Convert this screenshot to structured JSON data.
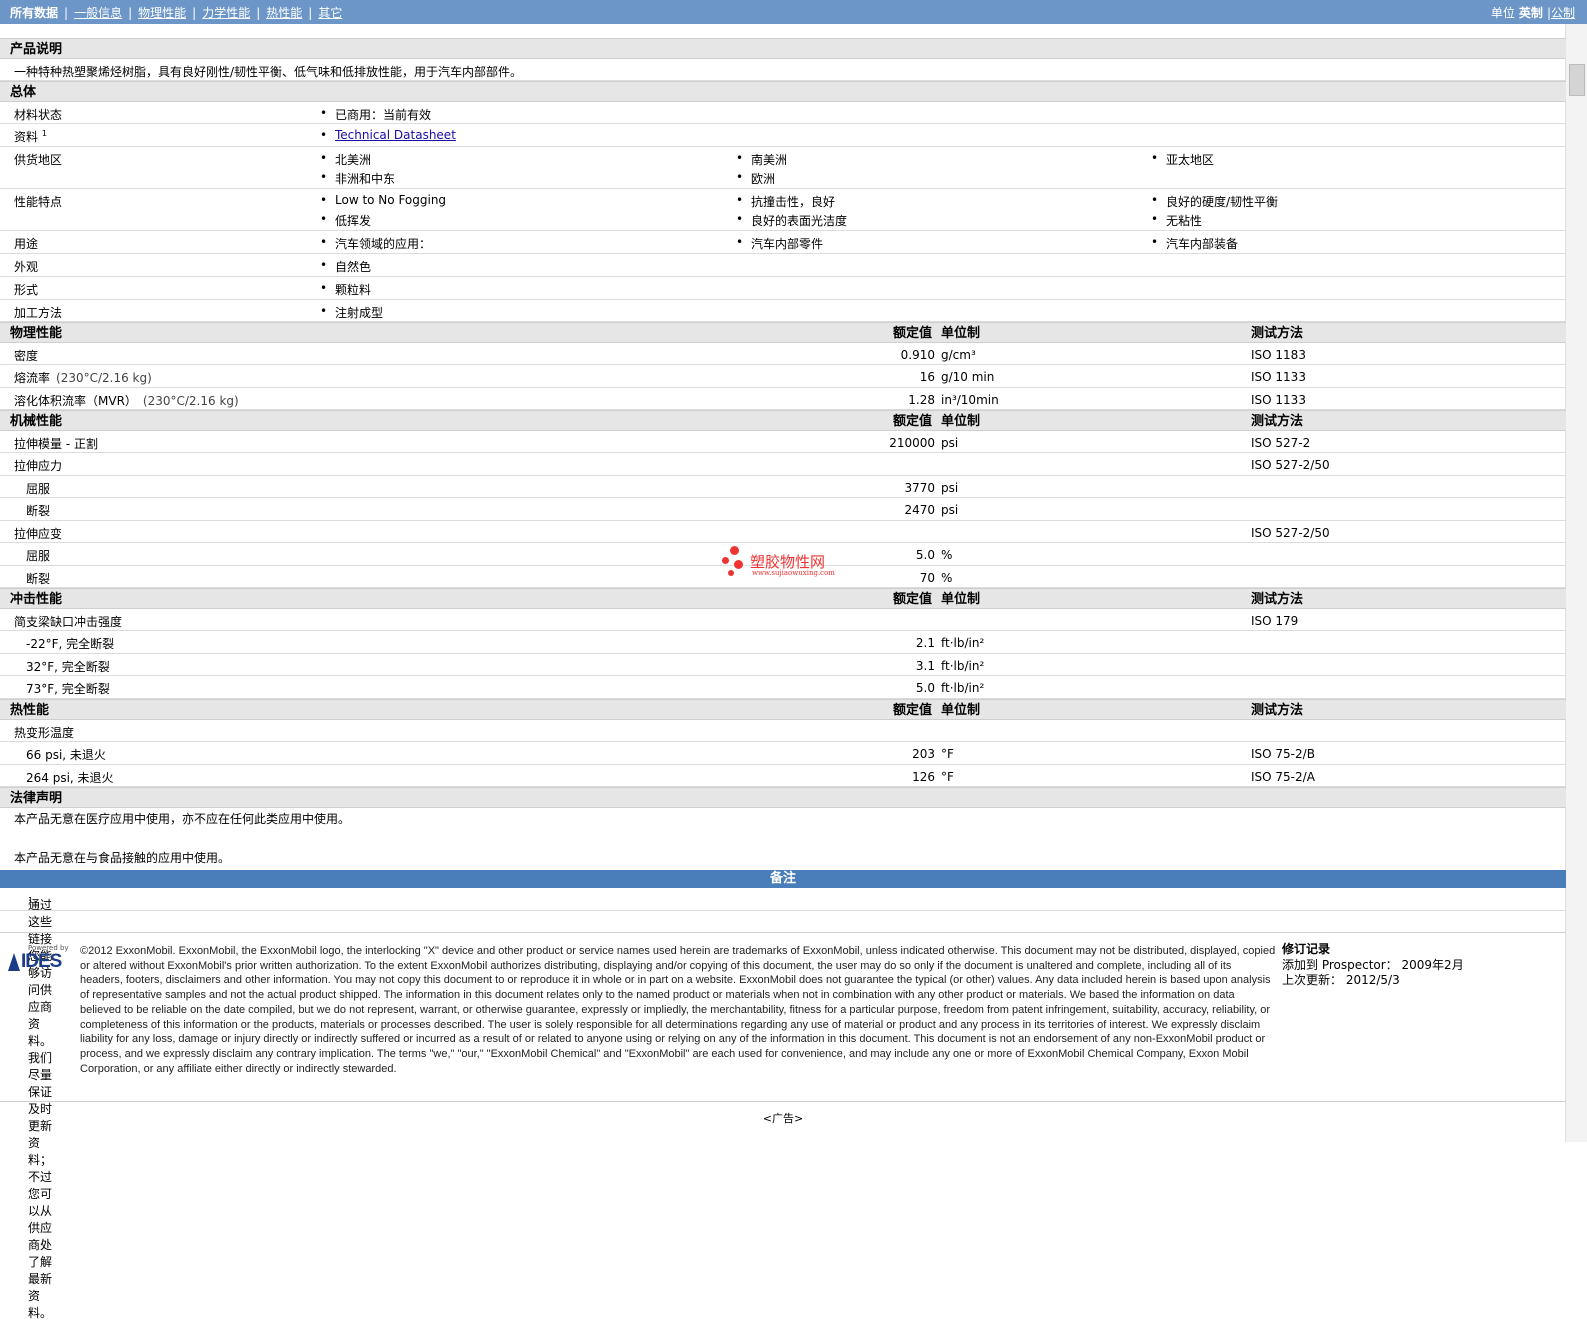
{
  "nav": {
    "items": [
      "所有数据",
      "一般信息",
      "物理性能",
      "力学性能",
      "热性能",
      "其它"
    ],
    "units_label": "单位",
    "unit_active": "英制",
    "unit_other": "公制"
  },
  "product_description": {
    "title": "产品说明",
    "text": "一种特种热塑聚烯烃树脂，具有良好刚性/韧性平衡、低气味和低排放性能，用于汽车内部部件。"
  },
  "general": {
    "title": "总体",
    "material_status": {
      "label": "材料状态",
      "values": [
        "已商用：当前有效"
      ]
    },
    "documents": {
      "label": "资料",
      "sup": "1",
      "values": [
        "Technical Datasheet"
      ]
    },
    "availability": {
      "label": "供货地区",
      "values": [
        "北美洲",
        "南美洲",
        "亚太地区",
        "非洲和中东",
        "欧洲"
      ]
    },
    "features": {
      "label": "性能特点",
      "values": [
        "Low to No Fogging",
        "抗撞击性，良好",
        "良好的硬度/韧性平衡",
        "低挥发",
        "良好的表面光洁度",
        "无粘性"
      ]
    },
    "uses": {
      "label": "用途",
      "values": [
        "汽车领域的应用：",
        "汽车内部零件",
        "汽车内部装备"
      ]
    },
    "appearance": {
      "label": "外观",
      "values": [
        "自然色"
      ]
    },
    "form": {
      "label": "形式",
      "values": [
        "颗粒料"
      ]
    },
    "processing": {
      "label": "加工方法",
      "values": [
        "注射成型"
      ]
    }
  },
  "headers": {
    "value": "额定值",
    "unit": "单位制",
    "test": "测试方法"
  },
  "physical": {
    "title": "物理性能",
    "rows": [
      {
        "label": "密度",
        "cond": "",
        "value": "0.910",
        "unit": "g/cm³",
        "test": "ISO 1183"
      },
      {
        "label": "熔流率",
        "cond": "(230°C/2.16 kg)",
        "value": "16",
        "unit": "g/10 min",
        "test": "ISO 1133"
      },
      {
        "label": "溶化体积流率（MVR）",
        "cond": "(230°C/2.16 kg)",
        "value": "1.28",
        "unit": "in³/10min",
        "test": "ISO 1133"
      }
    ]
  },
  "mechanical": {
    "title": "机械性能",
    "rows": [
      {
        "label": "拉伸模量 - 正割",
        "value": "210000",
        "unit": "psi",
        "test": "ISO 527-2"
      },
      {
        "label": "拉伸应力",
        "value": "",
        "unit": "",
        "test": "ISO 527-2/50"
      },
      {
        "label": "屈服",
        "value": "3770",
        "unit": "psi",
        "test": ""
      },
      {
        "label": "断裂",
        "value": "2470",
        "unit": "psi",
        "test": ""
      },
      {
        "label": "拉伸应变",
        "value": "",
        "unit": "",
        "test": "ISO 527-2/50"
      },
      {
        "label": "屈服",
        "value": "5.0",
        "unit": "%",
        "test": ""
      },
      {
        "label": "断裂",
        "value": "70",
        "unit": "%",
        "test": ""
      }
    ]
  },
  "impact": {
    "title": "冲击性能",
    "rows": [
      {
        "label": "简支梁缺口冲击强度",
        "value": "",
        "unit": "",
        "test": "ISO 179"
      },
      {
        "label": "-22°F, 完全断裂",
        "value": "2.1",
        "unit": "ft·lb/in²",
        "test": ""
      },
      {
        "label": "32°F, 完全断裂",
        "value": "3.1",
        "unit": "ft·lb/in²",
        "test": ""
      },
      {
        "label": "73°F, 完全断裂",
        "value": "5.0",
        "unit": "ft·lb/in²",
        "test": ""
      }
    ]
  },
  "thermal": {
    "title": "热性能",
    "rows": [
      {
        "label": "热变形温度",
        "value": "",
        "unit": "",
        "test": ""
      },
      {
        "label": "66 psi, 未退火",
        "value": "203",
        "unit": "°F",
        "test": "ISO 75-2/B"
      },
      {
        "label": "264 psi, 未退火",
        "value": "126",
        "unit": "°F",
        "test": "ISO 75-2/A"
      }
    ]
  },
  "legal": {
    "title": "法律声明",
    "p1": "本产品无意在医疗应用中使用，亦不应在任何此类应用中使用。",
    "p2": "本产品无意在与食品接触的应用中使用。"
  },
  "notes": {
    "title": "备注",
    "sup": "1",
    "text": "通过这些链接您能够访问供应商资料。我们尽量保证及时更新资料；不过您可以从供应商处了解最新资料。"
  },
  "footer": {
    "logo_small": "Powered by",
    "logo_text": "IDES",
    "legal_text": "©2012 ExxonMobil. ExxonMobil, the ExxonMobil logo, the interlocking \"X\" device and other product or service names used herein are trademarks of ExxonMobil, unless indicated otherwise. This document may not be distributed, displayed, copied or altered without ExxonMobil's prior written authorization. To the extent ExxonMobil authorizes distributing, displaying and/or copying of this document, the user may do so only if the document is unaltered and complete, including all of its headers, footers, disclaimers and other information. You may not copy this document to or reproduce it in whole or in part on a website. ExxonMobil does not guarantee the typical (or other) values. Any data included herein is based upon analysis of representative samples and not the actual product shipped. The information in this document relates only to the named product or materials when not in combination with any other product or materials. We based the information on data believed to be reliable on the date compiled, but we do not represent, warrant, or otherwise guarantee, expressly or impliedly, the merchantability, fitness for a particular purpose, freedom from patent infringement, suitability, accuracy, reliability, or completeness of this information or the products, materials or processes described. The user is solely responsible for all determinations regarding any use of material or product and any process in its territories of interest. We expressly disclaim liability for any loss, damage or injury directly or indirectly suffered or incurred as a result of or related to anyone using or relying on any of the information in this document. This document is not an endorsement of any non-ExxonMobil product or process, and we expressly disclaim any contrary implication. The terms \"we,\" \"our,\" \"ExxonMobil Chemical\" and \"ExxonMobil\" are each used for convenience, and may include any one or more of ExxonMobil Chemical Company, Exxon Mobil Corporation, or any affiliate either directly or indirectly stewarded.",
    "revision_title": "修订记录",
    "added_label": "添加到 Prospector：",
    "added_value": "2009年2月",
    "updated_label": "上次更新：",
    "updated_value": "2012/5/3",
    "ad": "<广告>"
  },
  "watermark": {
    "text": "塑胶物性网",
    "url": "www.sujiaowuxing.com"
  },
  "colors": {
    "topbar": "#6b96c7",
    "notes_bar": "#4a7eba",
    "section_bg": "#e6e6e6",
    "watermark": "#ee3333"
  }
}
